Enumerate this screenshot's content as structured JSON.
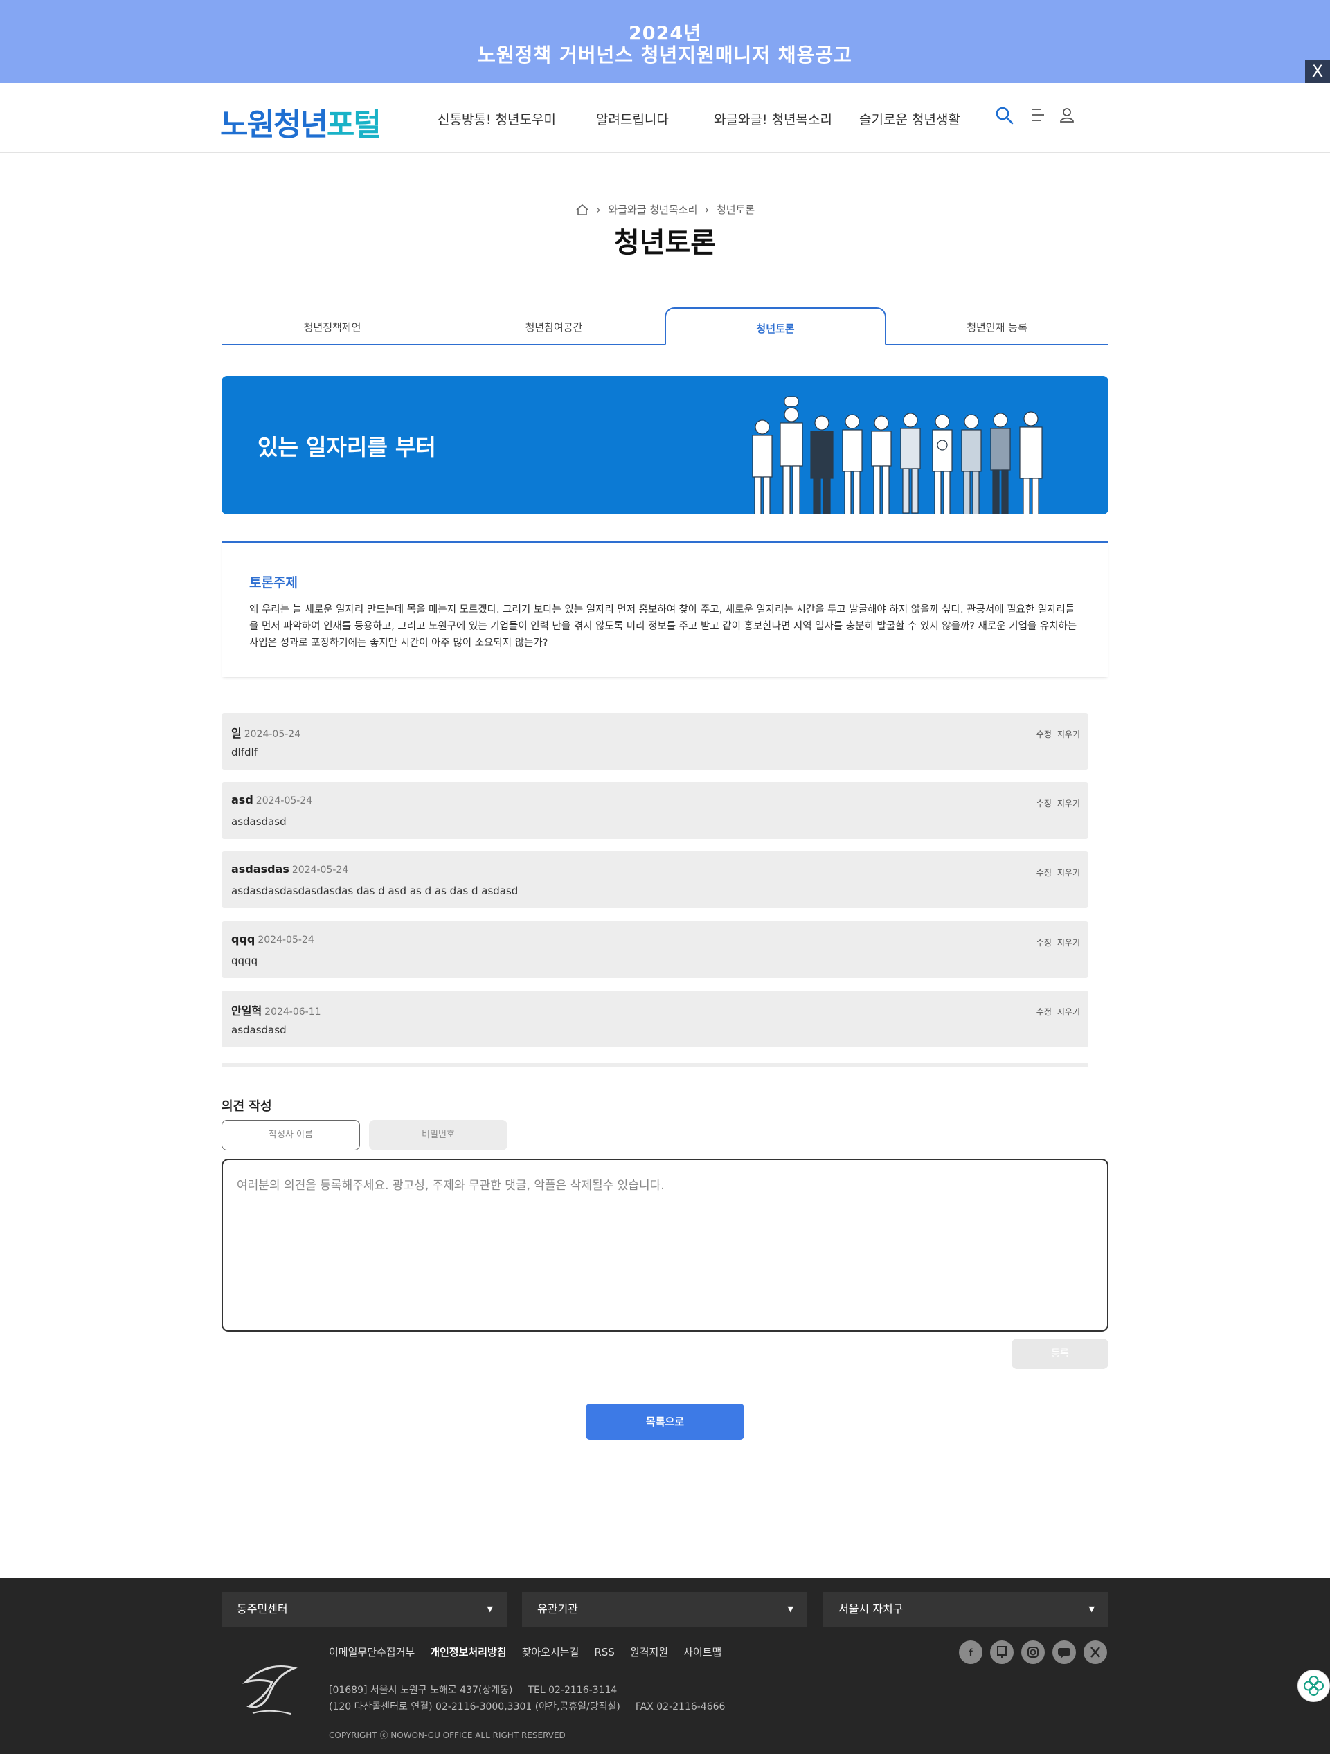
{
  "promo": {
    "line1": "2024년",
    "line2": "노원정책 거버넌스 청년지원매니저 채용공고",
    "close": "X"
  },
  "header": {
    "logo_main": "노원청년",
    "logo_hl": "포털",
    "nav": [
      "신통방통! 청년도우미",
      "알려드립니다",
      "와글와글! 청년목소리",
      "슬기로운 청년생활"
    ]
  },
  "breadcrumb": {
    "items": [
      "와글와글 청년목소리",
      "청년토론"
    ]
  },
  "page_title": "청년토론",
  "tabs": [
    {
      "label": "청년정책제언"
    },
    {
      "label": "청년참여공간"
    },
    {
      "label": "청년토론"
    },
    {
      "label": "청년인재 등록"
    }
  ],
  "hero": {
    "text": "있는 일자리를 부터"
  },
  "topic": {
    "label": "토론주제",
    "body": "왜 우리는 늘 새로운 일자리 만드는데 목을 매는지 모르겠다. 그러기 보다는 있는 일자리 먼저 홍보하여 찾아 주고, 새로운 일자리는 시간을 두고 발굴해야 하지 않을까 싶다. 관공서에 필요한 일자리들을 먼저 파악하여 인재를 등용하고, 그리고 노원구에 있는 기업들이 인력 난을 겪지 않도록 미리 정보를 주고 받고 같이 홍보한다면 지역 일자를 충분히 발굴할 수 있지 않을까? 새로운 기업을 유치하는 사업은 성과로 포장하기에는 좋지만 시간이 아주 많이 소요되지 않는가?"
  },
  "comments": [
    {
      "author": "일",
      "date": "2024-05-24",
      "text": "dlfdlf",
      "edit": "수정",
      "delete": "지우기"
    },
    {
      "author": "asd",
      "date": "2024-05-24",
      "text": "asdasdasd",
      "edit": "수정",
      "delete": "지우기"
    },
    {
      "author": "asdasdas",
      "date": "2024-05-24",
      "text": "asdasdasdasdasdasdas das d asd as d as das d asdasd",
      "edit": "수정",
      "delete": "지우기"
    },
    {
      "author": "qqq",
      "date": "2024-05-24",
      "text": "qqqq",
      "edit": "수정",
      "delete": "지우기"
    },
    {
      "author": "안일혁",
      "date": "2024-06-11",
      "text": "asdasdasd",
      "edit": "수정",
      "delete": "지우기"
    }
  ],
  "write": {
    "title": "의견 작성",
    "name_placeholder": "작성사 이름",
    "password_placeholder": "비밀번호",
    "textarea_placeholder": "여러분의 의견을 등록해주세요. 광고성, 주제와 무관한 댓글, 악플은 삭제될수 있습니다.",
    "submit": "등록"
  },
  "list_button": "목록으로",
  "footer": {
    "selects": [
      "동주민센터",
      "유관기관",
      "서울시 자치구"
    ],
    "links": [
      "이메일무단수집거부",
      "개인정보처리방침",
      "찾아오시는길",
      "RSS",
      "원격지원",
      "사이트맵"
    ],
    "address1": "[01689] 서울시 노원구 노해로 437(상계동)",
    "tel": "TEL 02-2116-3114",
    "address2": "(120 다산콜센터로 연결) 02-2116-3000,3301 (야간,공휴일/당직실)",
    "fax": "FAX 02-2116-4666",
    "copyright": "COPYRIGHT ⓒ NOWON-GU OFFICE ALL RIGHT RESERVED",
    "social_icons": [
      "facebook-icon",
      "blog-icon",
      "instagram-icon",
      "talk-icon",
      "x-icon"
    ]
  },
  "colors": {
    "primary": "#2e6fd1",
    "hero": "#0c7ad4",
    "promo": "#84a6f3",
    "footer": "#262626"
  }
}
